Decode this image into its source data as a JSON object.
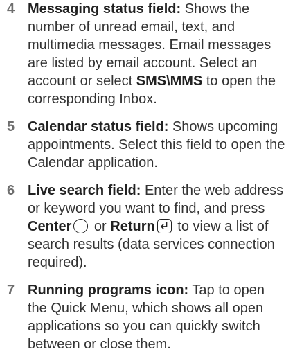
{
  "items": [
    {
      "number": "4",
      "term": "Messaging status field:",
      "text_a": " Shows the number of unread email, text, and multimedia messages. Email messages are listed by email account. Select an account or select ",
      "bold_a": "SMS\\MMS",
      "text_b": " to open the corresponding Inbox."
    },
    {
      "number": "5",
      "term": "Calendar status field:",
      "text_a": " Shows upcoming appointments. Select this field to open the Calendar application."
    },
    {
      "number": "6",
      "term": "Live search field:",
      "text_a": " Enter the web address or keyword you want to find, and press ",
      "bold_a": "Center",
      "text_b": " or ",
      "bold_b": "Return",
      "text_c": " to view a list of search results (data services connection required).",
      "icon_a": "center-button-icon",
      "icon_b": "return-key-icon"
    },
    {
      "number": "7",
      "term": "Running programs icon:",
      "text_a": " Tap to open the Quick Menu, which shows all open applications so you can quickly switch between or close them."
    }
  ]
}
